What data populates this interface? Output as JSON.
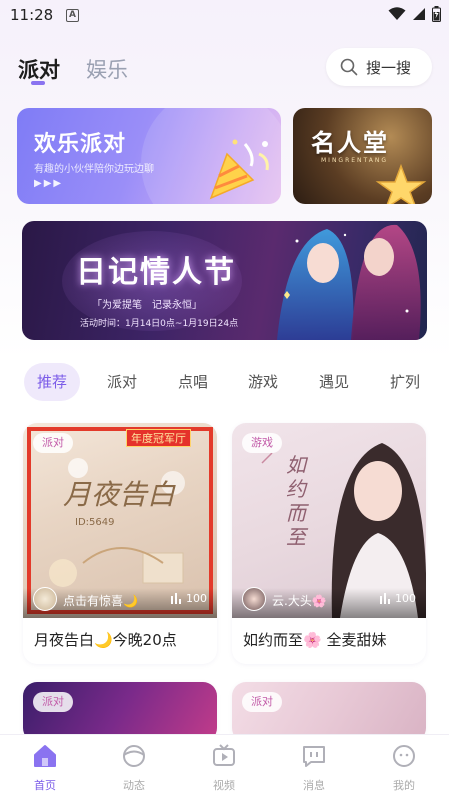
{
  "status_bar": {
    "time": "11:28",
    "notification_badge": "A",
    "icons": [
      "wifi-icon",
      "signal-icon",
      "battery-icon"
    ]
  },
  "top_tabs": [
    {
      "label": "派对",
      "active": true
    },
    {
      "label": "娱乐",
      "active": false
    }
  ],
  "search": {
    "label": "搜一搜",
    "icon": "search-icon"
  },
  "promos": [
    {
      "title": "欢乐派对",
      "subtitle": "有趣的小伙伴陪你边玩边聊",
      "arrows": "▶▶▶"
    },
    {
      "title": "名人堂",
      "subtitle": "MINGRENTANG"
    }
  ],
  "banner": {
    "title": "日记情人节",
    "quote": "「为爱提笔　记录永恒」",
    "time": "活动时间：1月14日0点~1月19日24点"
  },
  "categories": [
    {
      "label": "推荐",
      "active": true
    },
    {
      "label": "派对",
      "active": false
    },
    {
      "label": "点唱",
      "active": false
    },
    {
      "label": "游戏",
      "active": false
    },
    {
      "label": "遇见",
      "active": false
    },
    {
      "label": "扩列",
      "active": false
    }
  ],
  "cards": [
    {
      "tag": "派对",
      "badge": "年度冠军厅",
      "art_text": "月夜告白",
      "room_no": "ID:5649",
      "host": "点击有惊喜🌙",
      "count": "100",
      "title": "月夜告白🌙今晚20点"
    },
    {
      "tag": "游戏",
      "art_text": "如约而至",
      "host": "云.大头🌸",
      "count": "100",
      "title": "如约而至🌸 全麦甜妹"
    },
    {
      "tag": "派对"
    },
    {
      "tag": "派对"
    }
  ],
  "bottom_nav": [
    {
      "label": "首页",
      "icon": "home-icon",
      "active": true
    },
    {
      "label": "动态",
      "icon": "moments-icon",
      "active": false
    },
    {
      "label": "视频",
      "icon": "video-icon",
      "active": false
    },
    {
      "label": "消息",
      "icon": "message-icon",
      "active": false
    },
    {
      "label": "我的",
      "icon": "profile-icon",
      "active": false
    }
  ],
  "colors": {
    "accent": "#7b5ce8",
    "tag_text": "#c25aa8"
  }
}
